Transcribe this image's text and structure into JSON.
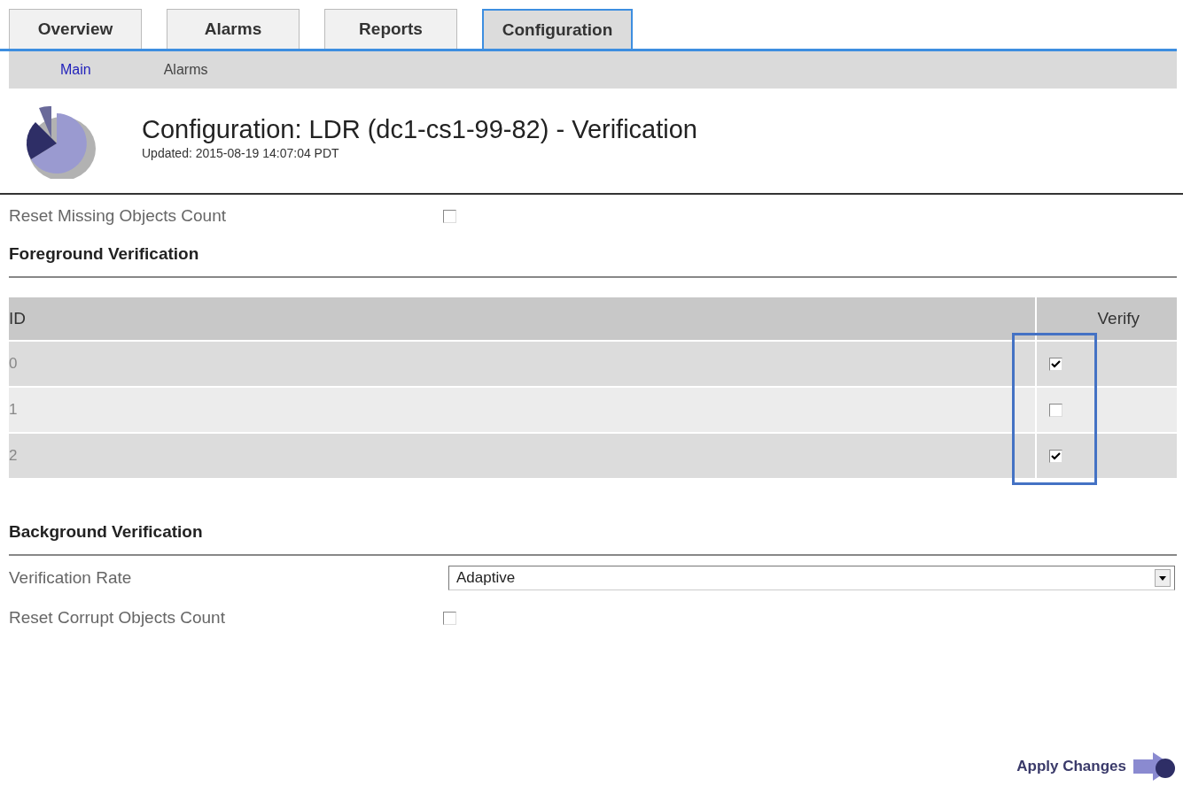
{
  "tabs": [
    {
      "label": "Overview",
      "selected": false
    },
    {
      "label": "Alarms",
      "selected": false
    },
    {
      "label": "Reports",
      "selected": false
    },
    {
      "label": "Configuration",
      "selected": true
    }
  ],
  "subtabs": [
    {
      "label": "Main",
      "selected": true
    },
    {
      "label": "Alarms",
      "selected": false
    }
  ],
  "header": {
    "title": "Configuration: LDR (dc1-cs1-99-82) - Verification",
    "updated": "Updated: 2015-08-19 14:07:04 PDT"
  },
  "reset_missing": {
    "label": "Reset Missing Objects Count",
    "checked": false
  },
  "foreground": {
    "heading": "Foreground Verification",
    "columns": [
      "ID",
      "Verify"
    ],
    "rows": [
      {
        "id": "0",
        "verify": true
      },
      {
        "id": "1",
        "verify": false
      },
      {
        "id": "2",
        "verify": true
      }
    ]
  },
  "background": {
    "heading": "Background Verification",
    "rate_label": "Verification Rate",
    "rate_value": "Adaptive",
    "reset_label": "Reset Corrupt Objects Count",
    "reset_checked": false
  },
  "apply_button": "Apply Changes"
}
